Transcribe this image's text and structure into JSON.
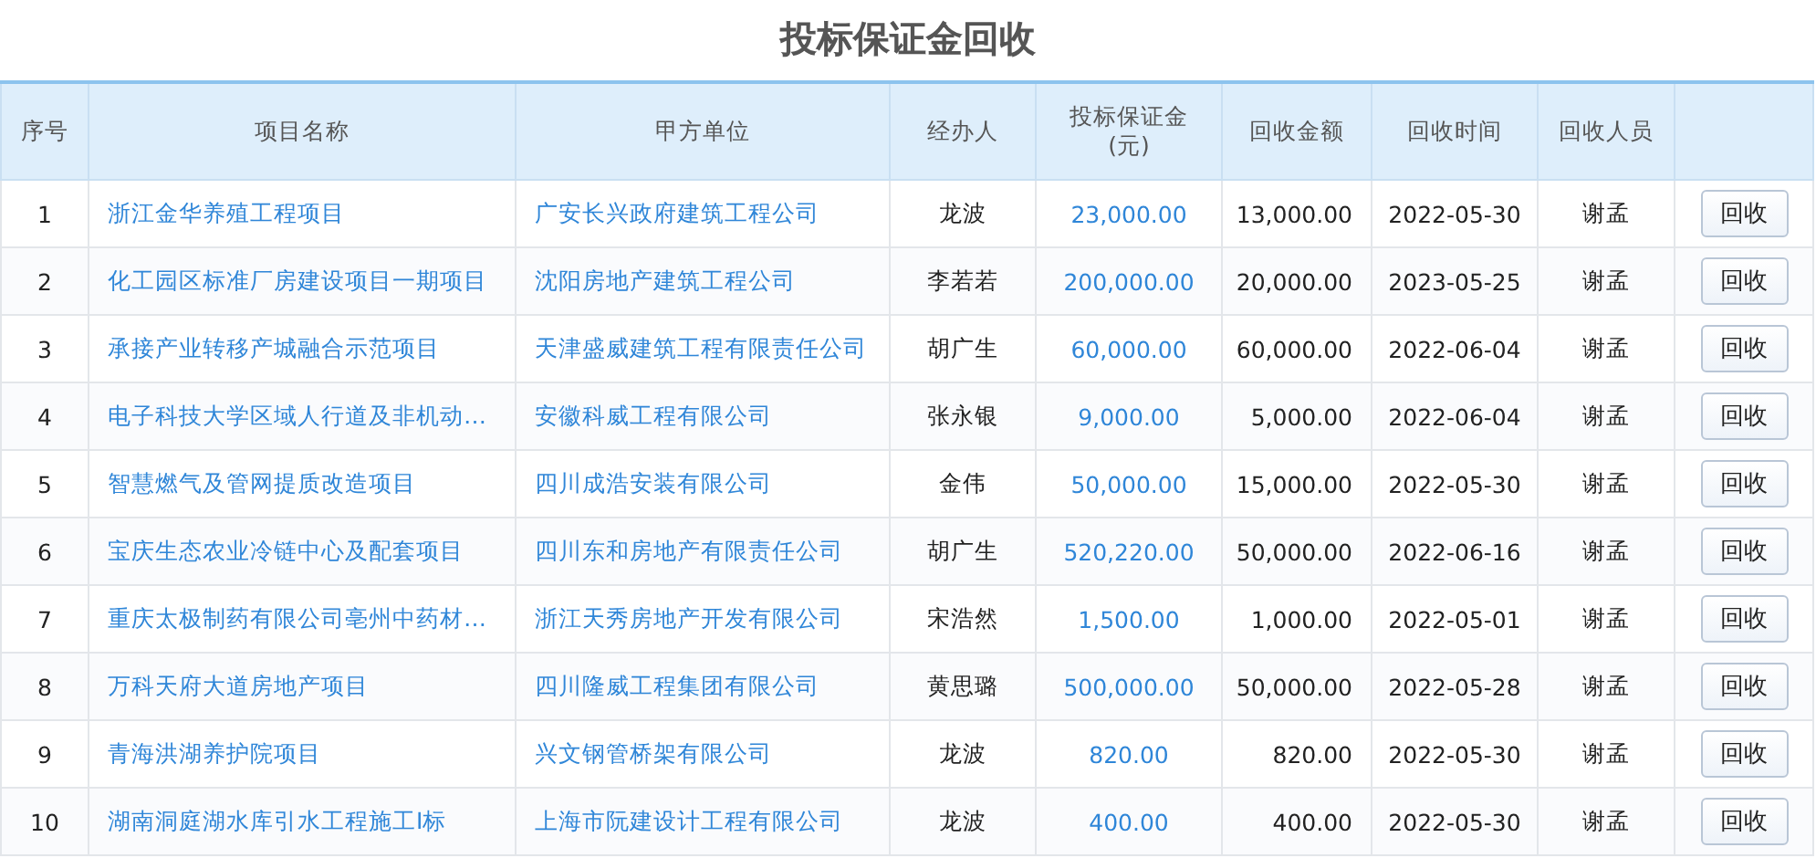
{
  "title": "投标保证金回收",
  "table": {
    "columns": [
      "序号",
      "项目名称",
      "甲方单位",
      "经办人",
      "投标保证金\n(元)",
      "回收金额",
      "回收时间",
      "回收人员"
    ],
    "rows": [
      {
        "no": "1",
        "project": "浙江金华养殖工程项目",
        "client": "广安长兴政府建筑工程公司",
        "handler": "龙波",
        "deposit": "23,000.00",
        "recovered": "13,000.00",
        "date": "2022-05-30",
        "recoverer": "谢孟",
        "action": "回收"
      },
      {
        "no": "2",
        "project": "化工园区标准厂房建设项目一期项目",
        "client": "沈阳房地产建筑工程公司",
        "handler": "李若若",
        "deposit": "200,000.00",
        "recovered": "20,000.00",
        "date": "2023-05-25",
        "recoverer": "谢孟",
        "action": "回收"
      },
      {
        "no": "3",
        "project": "承接产业转移产城融合示范项目",
        "client": "天津盛威建筑工程有限责任公司",
        "handler": "胡广生",
        "deposit": "60,000.00",
        "recovered": "60,000.00",
        "date": "2022-06-04",
        "recoverer": "谢孟",
        "action": "回收"
      },
      {
        "no": "4",
        "project": "电子科技大学区域人行道及非机动…",
        "client": "安徽科威工程有限公司",
        "handler": "张永银",
        "deposit": "9,000.00",
        "recovered": "5,000.00",
        "date": "2022-06-04",
        "recoverer": "谢孟",
        "action": "回收"
      },
      {
        "no": "5",
        "project": "智慧燃气及管网提质改造项目",
        "client": "四川成浩安装有限公司",
        "handler": "金伟",
        "deposit": "50,000.00",
        "recovered": "15,000.00",
        "date": "2022-05-30",
        "recoverer": "谢孟",
        "action": "回收"
      },
      {
        "no": "6",
        "project": "宝庆生态农业冷链中心及配套项目",
        "client": "四川东和房地产有限责任公司",
        "handler": "胡广生",
        "deposit": "520,220.00",
        "recovered": "50,000.00",
        "date": "2022-06-16",
        "recoverer": "谢孟",
        "action": "回收"
      },
      {
        "no": "7",
        "project": "重庆太极制药有限公司亳州中药材…",
        "client": "浙江天秀房地产开发有限公司",
        "handler": "宋浩然",
        "deposit": "1,500.00",
        "recovered": "1,000.00",
        "date": "2022-05-01",
        "recoverer": "谢孟",
        "action": "回收"
      },
      {
        "no": "8",
        "project": "万科天府大道房地产项目",
        "client": "四川隆威工程集团有限公司",
        "handler": "黄思璐",
        "deposit": "500,000.00",
        "recovered": "50,000.00",
        "date": "2022-05-28",
        "recoverer": "谢孟",
        "action": "回收"
      },
      {
        "no": "9",
        "project": "青海洪湖养护院项目",
        "client": "兴文钢管桥架有限公司",
        "handler": "龙波",
        "deposit": "820.00",
        "recovered": "820.00",
        "date": "2022-05-30",
        "recoverer": "谢孟",
        "action": "回收"
      },
      {
        "no": "10",
        "project": "湖南洞庭湖水库引水工程施工I标",
        "client": "上海市阮建设计工程有限公司",
        "handler": "龙波",
        "deposit": "400.00",
        "recovered": "400.00",
        "date": "2022-05-30",
        "recoverer": "谢孟",
        "action": "回收"
      }
    ]
  }
}
